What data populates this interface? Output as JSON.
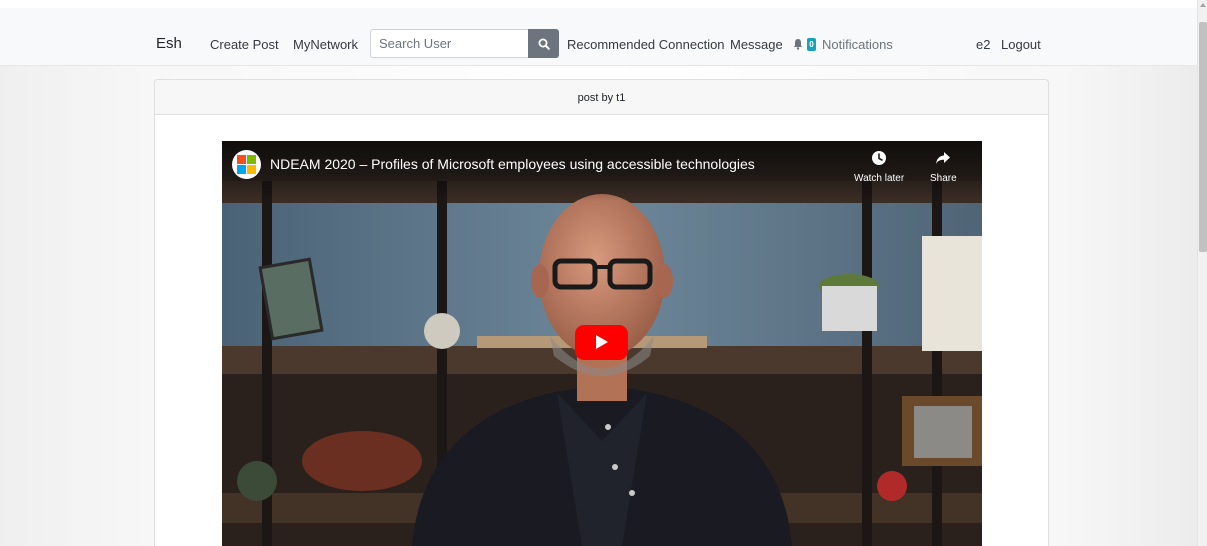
{
  "navbar": {
    "brand": "Esh",
    "links": {
      "create_post": "Create Post",
      "my_network": "MyNetwork",
      "recommended": "Recommended Connection",
      "message": "Message",
      "notifications": "Notifications",
      "user": "e2",
      "logout": "Logout"
    },
    "search": {
      "placeholder": "Search User",
      "value": ""
    },
    "notification_count": "0"
  },
  "post": {
    "header": "post by t1",
    "video": {
      "title": "NDEAM 2020 – Profiles of Microsoft employees using accessible technologies",
      "watch_later_label": "Watch later",
      "share_label": "Share"
    }
  },
  "colors": {
    "navbar_bg": "#f8f9fa",
    "search_button": "#6c757d",
    "badge": "#17a2b8",
    "play_button": "#ff0000"
  },
  "icons": [
    "search-icon",
    "bell-icon",
    "clock-icon",
    "share-icon",
    "play-icon",
    "microsoft-logo"
  ]
}
